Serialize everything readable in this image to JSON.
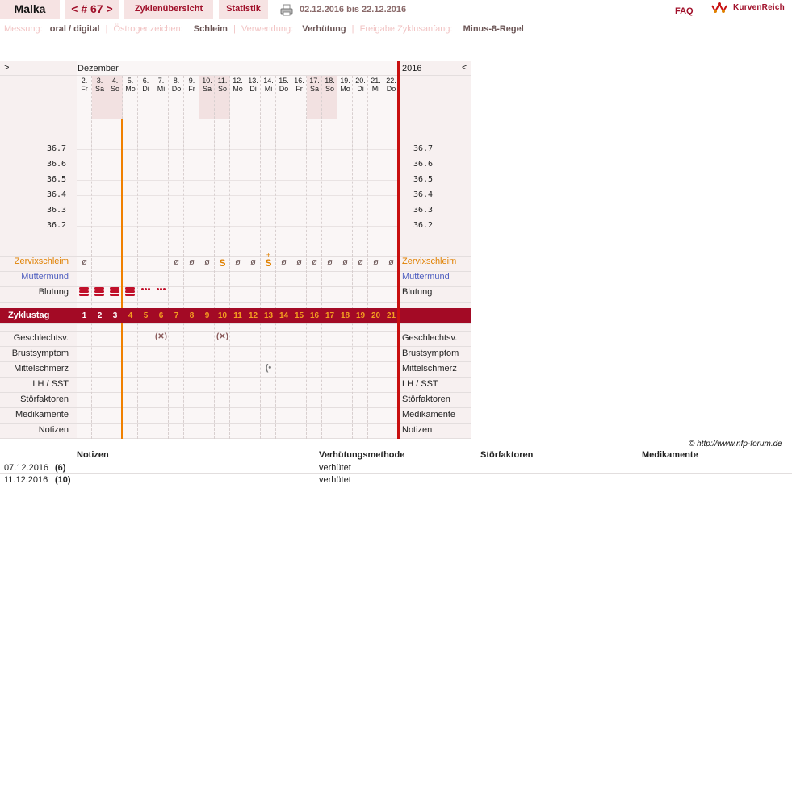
{
  "header": {
    "user": "Malka",
    "cycle": "< # 67 >",
    "overview": "Zyklenübersicht",
    "statistic": "Statistik",
    "date_range": "02.12.2016 bis 22.12.2016",
    "faq": "FAQ",
    "logo": "KurvenReich"
  },
  "info": {
    "measure_label": "Messung:",
    "measure_value": "oral / digital",
    "estrogen_label": "Östrogenzeichen:",
    "estrogen_value": "Schleim",
    "usage_label": "Verwendung:",
    "usage_value": "Verhütung",
    "release_label": "Freigabe Zyklusanfang:",
    "release_value": "Minus-8-Regel"
  },
  "chart": {
    "nav_prev": ">",
    "nav_next": "<",
    "month": "Dezember",
    "year": "2016",
    "days": [
      {
        "num": "2.",
        "wd": "Fr",
        "we": false
      },
      {
        "num": "3.",
        "wd": "Sa",
        "we": true
      },
      {
        "num": "4.",
        "wd": "So",
        "we": true
      },
      {
        "num": "5.",
        "wd": "Mo",
        "we": false
      },
      {
        "num": "6.",
        "wd": "Di",
        "we": false
      },
      {
        "num": "7.",
        "wd": "Mi",
        "we": false
      },
      {
        "num": "8.",
        "wd": "Do",
        "we": false
      },
      {
        "num": "9.",
        "wd": "Fr",
        "we": false
      },
      {
        "num": "10.",
        "wd": "Sa",
        "we": true
      },
      {
        "num": "11.",
        "wd": "So",
        "we": true
      },
      {
        "num": "12.",
        "wd": "Mo",
        "we": false
      },
      {
        "num": "13.",
        "wd": "Di",
        "we": false
      },
      {
        "num": "14.",
        "wd": "Mi",
        "we": false
      },
      {
        "num": "15.",
        "wd": "Do",
        "we": false
      },
      {
        "num": "16.",
        "wd": "Fr",
        "we": false
      },
      {
        "num": "17.",
        "wd": "Sa",
        "we": true
      },
      {
        "num": "18.",
        "wd": "So",
        "we": true
      },
      {
        "num": "19.",
        "wd": "Mo",
        "we": false
      },
      {
        "num": "20.",
        "wd": "Di",
        "we": false
      },
      {
        "num": "21.",
        "wd": "Mi",
        "we": false
      },
      {
        "num": "22.",
        "wd": "Do",
        "we": false
      }
    ],
    "temps": [
      "36.7",
      "36.6",
      "36.5",
      "36.4",
      "36.3",
      "36.2"
    ],
    "mucus": [
      "ø",
      "",
      "",
      "",
      "",
      "",
      "ø",
      "ø",
      "ø",
      "S",
      "ø",
      "ø",
      "S+",
      "ø",
      "ø",
      "ø",
      "ø",
      "ø",
      "ø",
      "ø",
      "ø"
    ],
    "bleeding": [
      "strong",
      "strong",
      "strong",
      "strong",
      "light",
      "light",
      "",
      "",
      "",
      "",
      "",
      "",
      "",
      "",
      "",
      "",
      "",
      "",
      "",
      "",
      ""
    ],
    "cycle_days": [
      "1",
      "2",
      "3",
      "4",
      "5",
      "6",
      "7",
      "8",
      "9",
      "10",
      "11",
      "12",
      "13",
      "14",
      "15",
      "16",
      "17",
      "18",
      "19",
      "20",
      "21"
    ],
    "sex_days": [
      5,
      9
    ],
    "pain_days": [
      12
    ],
    "labels": {
      "mucus": "Zervixschleim",
      "cervix": "Muttermund",
      "bleeding": "Blutung",
      "cycleday": "Zyklustag",
      "sex": "Geschlechtsv.",
      "breast": "Brustsymptom",
      "pain": "Mittelschmerz",
      "lh": "LH / SST",
      "disturb": "Störfaktoren",
      "meds": "Medikamente",
      "notes": "Notizen"
    },
    "colors": {
      "accent": "#a0102a",
      "orange": "#f08000",
      "mucus_label": "#e08000",
      "cervix_label": "#5060c0"
    }
  },
  "copyright": "© http://www.nfp-forum.de",
  "table": {
    "headers": [
      "Notizen",
      "Verhütungsmethode",
      "Störfaktoren",
      "Medikamente"
    ],
    "rows": [
      {
        "date": "07.12.2016",
        "day": "(6)",
        "method": "verhütet"
      },
      {
        "date": "11.12.2016",
        "day": "(10)",
        "method": "verhütet"
      }
    ]
  }
}
